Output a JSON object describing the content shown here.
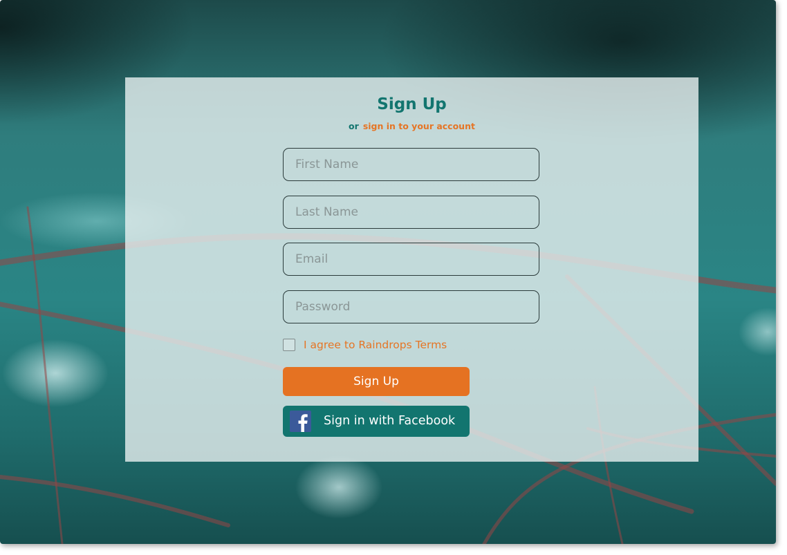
{
  "form": {
    "title": "Sign Up",
    "subtitle_prefix": "or",
    "signin_link": "sign in to your account",
    "fields": {
      "first_name_placeholder": "First Name",
      "last_name_placeholder": "Last Name",
      "email_placeholder": "Email",
      "password_placeholder": "Password"
    },
    "agree_label": "I agree to Raindrops Terms",
    "agree_checked": false,
    "signup_button": "Sign Up",
    "facebook_button": "Sign in with Facebook"
  },
  "icons": {
    "facebook": "facebook-icon"
  },
  "colors": {
    "accent_teal": "#12756f",
    "accent_orange": "#e57222",
    "facebook_blue": "#3b5a9a"
  }
}
